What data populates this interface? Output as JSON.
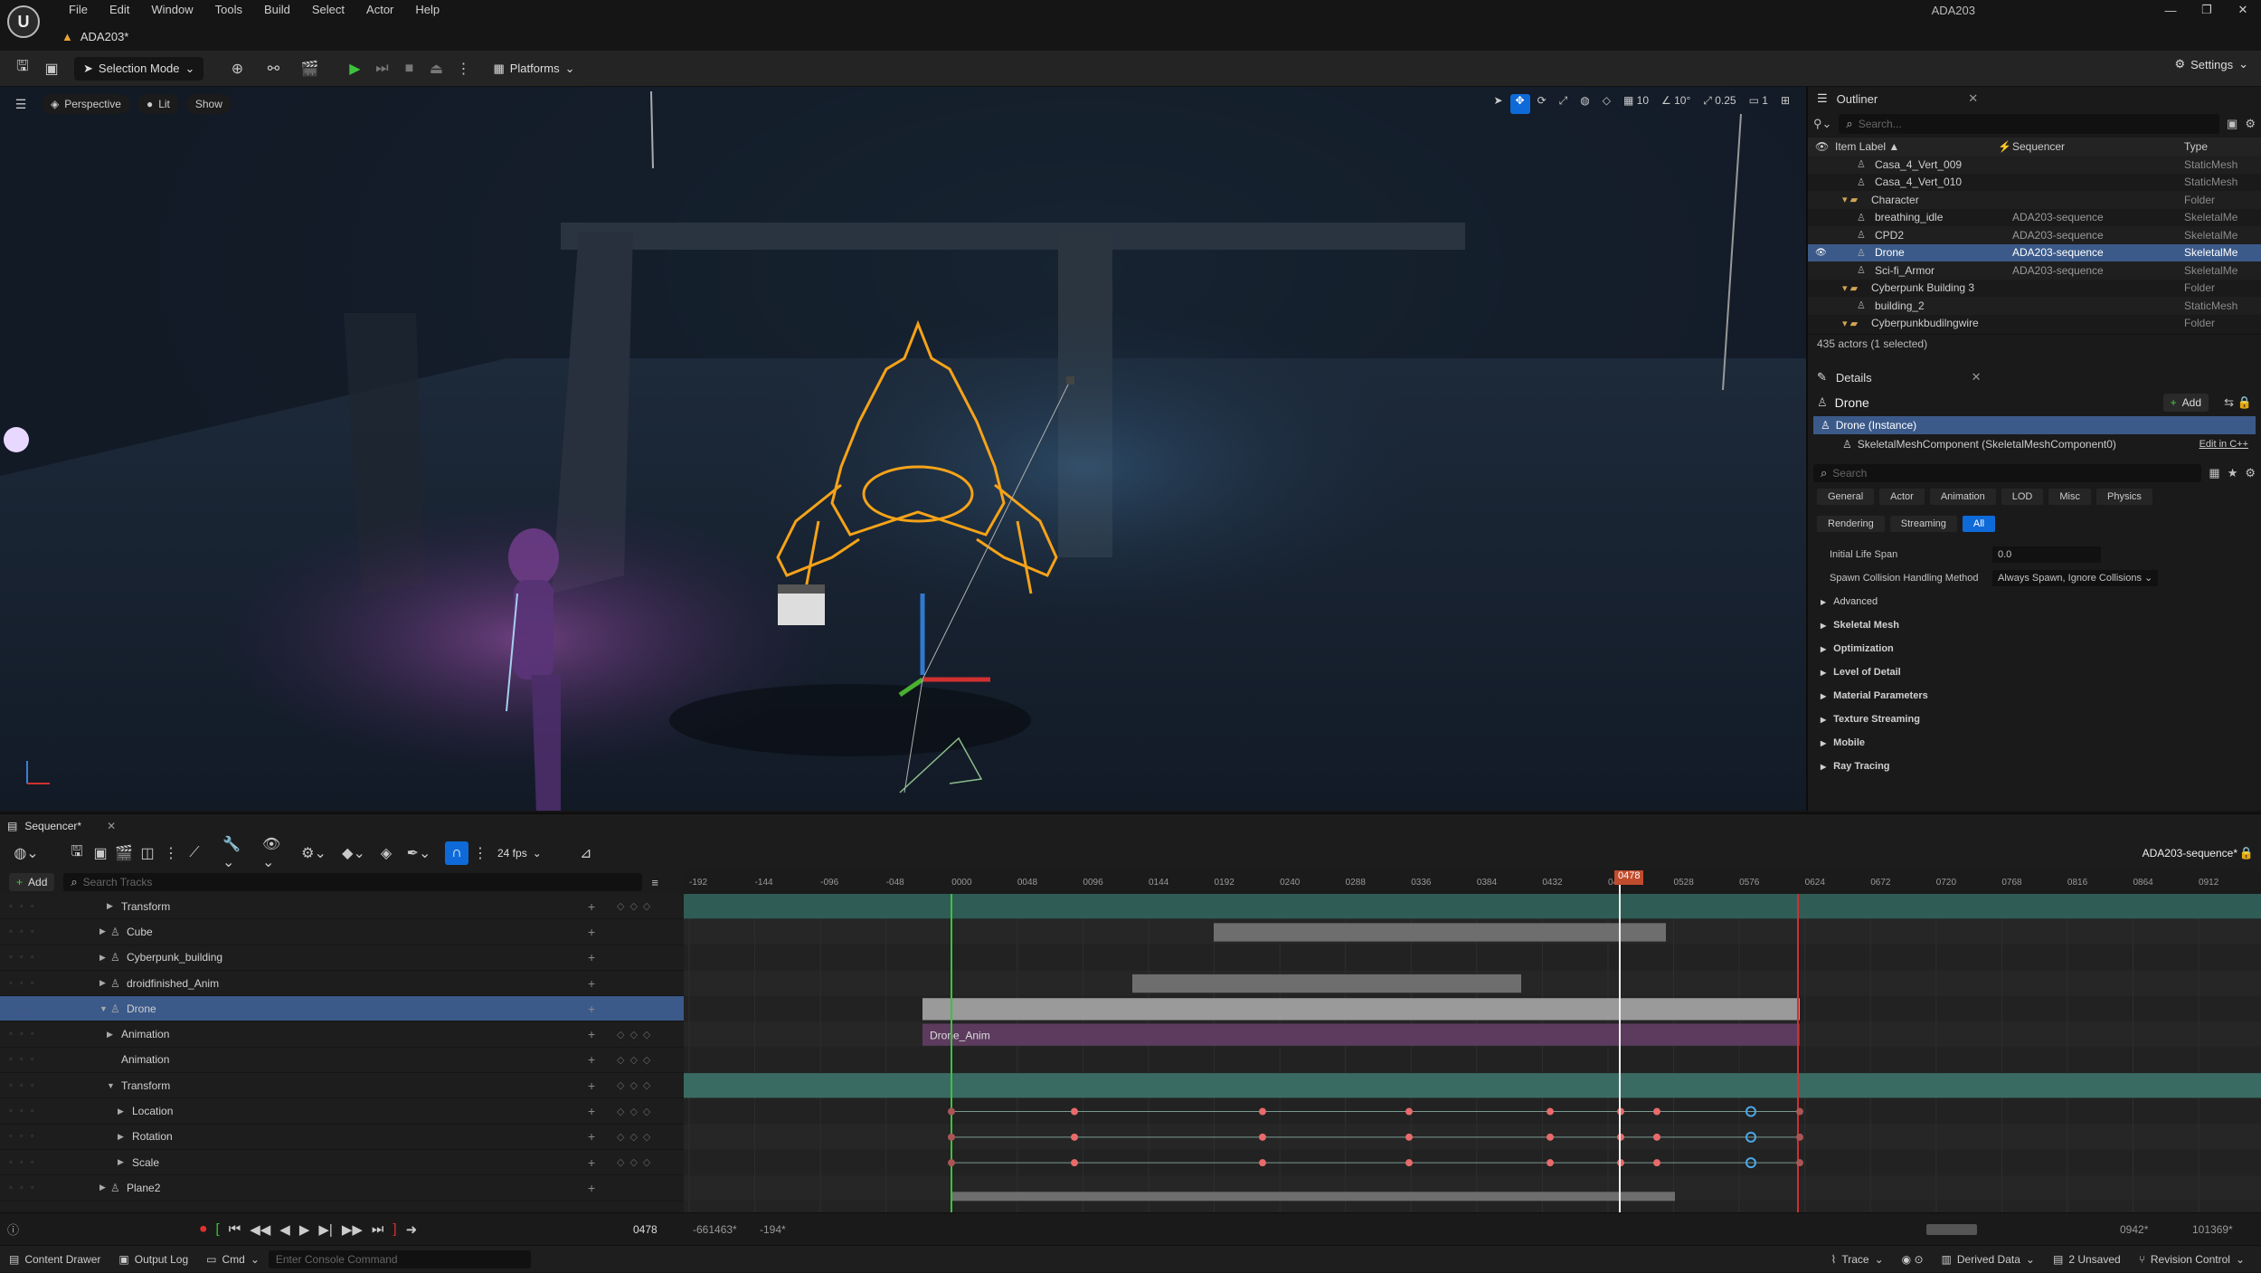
{
  "app": {
    "logo": "U",
    "tab_title": "ADA203*",
    "window_title": "ADA203"
  },
  "menu": [
    "File",
    "Edit",
    "Window",
    "Tools",
    "Build",
    "Select",
    "Actor",
    "Help"
  ],
  "toolbar": {
    "mode": "Selection Mode",
    "platforms": "Platforms",
    "settings": "Settings"
  },
  "viewport": {
    "perspective": "Perspective",
    "lit": "Lit",
    "show": "Show",
    "grid_snap": "10",
    "rot_snap": "10°",
    "scale_snap": "0.25",
    "camera_speed": "1"
  },
  "outliner": {
    "title": "Outliner",
    "search_placeholder": "Search...",
    "columns": {
      "label": "Item Label ▲",
      "sequencer": "Sequencer",
      "type": "Type"
    },
    "rows": [
      {
        "label": "Casa_4_Vert_009",
        "seq": "",
        "type": "StaticMesh",
        "indent": 2
      },
      {
        "label": "Casa_4_Vert_010",
        "seq": "",
        "type": "StaticMesh",
        "indent": 2
      },
      {
        "label": "Character",
        "seq": "",
        "type": "Folder",
        "indent": 1
      },
      {
        "label": "breathing_idle",
        "seq": "ADA203-sequence",
        "type": "SkeletalMe",
        "indent": 2
      },
      {
        "label": "CPD2",
        "seq": "ADA203-sequence",
        "type": "SkeletalMe",
        "indent": 2
      },
      {
        "label": "Drone",
        "seq": "ADA203-sequence",
        "type": "SkeletalMe",
        "indent": 2
      },
      {
        "label": "Sci-fi_Armor",
        "seq": "ADA203-sequence",
        "type": "SkeletalMe",
        "indent": 2
      },
      {
        "label": "Cyberpunk Building 3",
        "seq": "",
        "type": "Folder",
        "indent": 1
      },
      {
        "label": "building_2",
        "seq": "",
        "type": "StaticMesh",
        "indent": 2
      },
      {
        "label": "Cyberpunkbudilngwire",
        "seq": "",
        "type": "Folder",
        "indent": 1
      }
    ],
    "footer": "435 actors (1 selected)"
  },
  "details": {
    "title": "Details",
    "actor": "Drone",
    "add": "Add",
    "instance": "Drone (Instance)",
    "component": "SkeletalMeshComponent (SkeletalMeshComponent0)",
    "edit_cpp": "Edit in C++",
    "search_placeholder": "Search",
    "categories": [
      "General",
      "Actor",
      "Animation",
      "LOD",
      "Misc",
      "Physics",
      "Rendering",
      "Streaming",
      "All"
    ],
    "initial_life_span_label": "Initial Life Span",
    "initial_life_span": "0.0",
    "spawn_label": "Spawn Collision Handling Method",
    "spawn_value": "Always Spawn, Ignore Collisions",
    "sections": [
      "Advanced",
      "Skeletal Mesh",
      "Optimization",
      "Level of Detail",
      "Material Parameters",
      "Texture Streaming",
      "Mobile",
      "Ray Tracing"
    ]
  },
  "sequencer": {
    "tab": "Sequencer*",
    "fps": "24 fps",
    "sequence_name": "ADA203-sequence*",
    "add": "Add",
    "search_placeholder": "Search Tracks",
    "playhead": "0478",
    "ruler": [
      "-192",
      "-144",
      "-096",
      "-048",
      "0000",
      "0048",
      "0096",
      "0144",
      "0192",
      "0240",
      "0288",
      "0336",
      "0384",
      "0432",
      "0480",
      "0528",
      "0576",
      "0624",
      "0672",
      "0720",
      "0768",
      "0816",
      "0864",
      "0912"
    ],
    "tracks": [
      {
        "label": "Transform",
        "depth": 1,
        "exp": "▶"
      },
      {
        "label": "Cube",
        "depth": 0,
        "exp": "▶"
      },
      {
        "label": "Cyberpunk_building",
        "depth": 0,
        "exp": "▶"
      },
      {
        "label": "droidfinished_Anim",
        "depth": 0,
        "exp": "▶"
      },
      {
        "label": "Drone",
        "depth": 0,
        "exp": "▼"
      },
      {
        "label": "Animation",
        "depth": 1,
        "exp": "▶"
      },
      {
        "label": "Animation",
        "depth": 1,
        "exp": ""
      },
      {
        "label": "Transform",
        "depth": 1,
        "exp": "▼"
      },
      {
        "label": "Location",
        "depth": 2,
        "exp": "▶"
      },
      {
        "label": "Rotation",
        "depth": 2,
        "exp": "▶"
      },
      {
        "label": "Scale",
        "depth": 2,
        "exp": "▶"
      },
      {
        "label": "Plane2",
        "depth": 0,
        "exp": "▶"
      }
    ],
    "clip_label": "Drone_Anim",
    "transport_frame": "0478",
    "range_start": "-661463*",
    "range_in": "-194*",
    "range_out": "0942*",
    "range_end": "101369*"
  },
  "statusbar": {
    "content_drawer": "Content Drawer",
    "output_log": "Output Log",
    "cmd": "Cmd",
    "console_placeholder": "Enter Console Command",
    "trace": "Trace",
    "derived": "Derived Data",
    "unsaved": "2 Unsaved",
    "revision": "Revision Control"
  }
}
